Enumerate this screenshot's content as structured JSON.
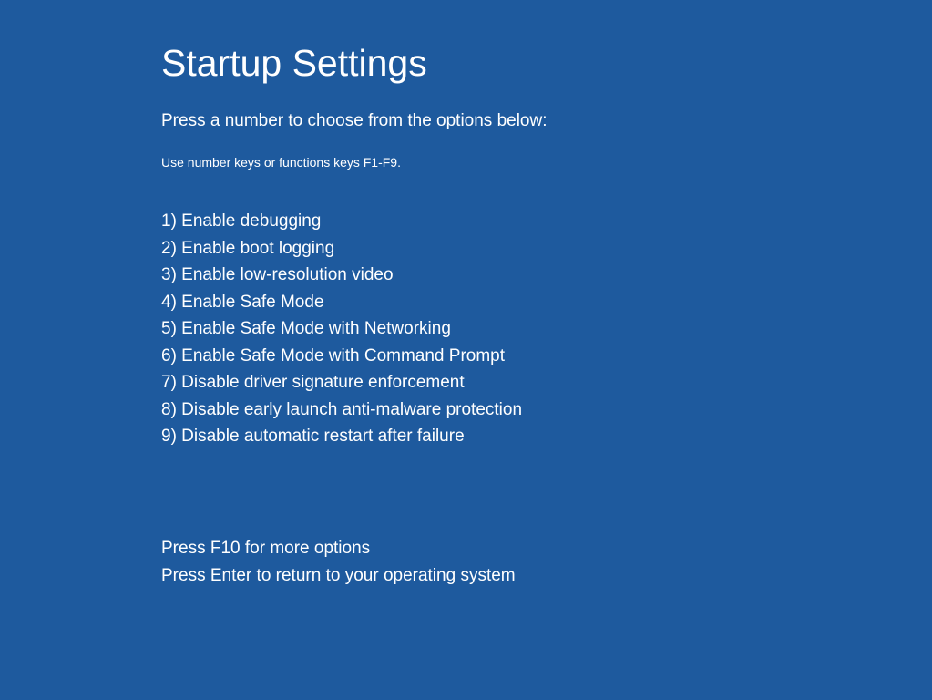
{
  "title": "Startup Settings",
  "instruction": "Press a number to choose from the options below:",
  "hint": "Use number keys or functions keys F1-F9.",
  "options": [
    "1) Enable debugging",
    "2) Enable boot logging",
    "3) Enable low-resolution video",
    "4) Enable Safe Mode",
    "5) Enable Safe Mode with Networking",
    "6) Enable Safe Mode with Command Prompt",
    "7) Disable driver signature enforcement",
    "8) Disable early launch anti-malware protection",
    "9) Disable automatic restart after failure"
  ],
  "footer": {
    "more_options": "Press F10 for more options",
    "return_hint": "Press Enter to return to your operating system"
  }
}
